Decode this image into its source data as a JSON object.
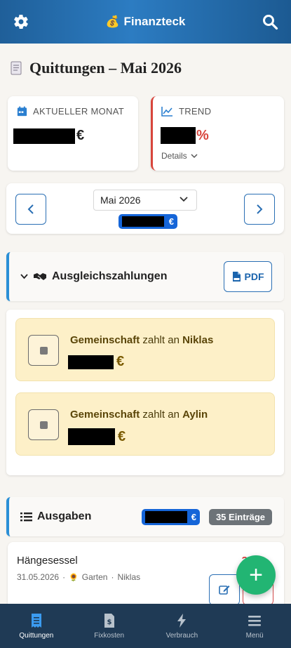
{
  "header": {
    "title": "Finanzteck",
    "brand_icon": "money-bag-icon",
    "left_icon": "gear-icon",
    "right_icon": "search-icon"
  },
  "page": {
    "title": "Quittungen – Mai 2026",
    "title_icon": "receipt-icon"
  },
  "stats": {
    "current_month": {
      "label": "AKTUELLER MONAT",
      "currency": "€"
    },
    "trend": {
      "label": "TREND",
      "unit": "%",
      "details_label": "Details"
    }
  },
  "month_nav": {
    "selected": "Mai 2026",
    "total_currency": "€"
  },
  "settlement": {
    "title": "Ausgleichszahlungen",
    "pdf_label": "PDF",
    "payments": [
      {
        "from": "Gemeinschaft",
        "verb": "zahlt an",
        "to": "Niklas",
        "currency": "€"
      },
      {
        "from": "Gemeinschaft",
        "verb": "zahlt an",
        "to": "Aylin",
        "currency": "€"
      }
    ]
  },
  "expenses": {
    "title": "Ausgaben",
    "total_currency": "€",
    "count_label": "35 Einträge",
    "items": [
      {
        "name": "Hängesessel",
        "date": "31.05.2026",
        "separator": "·",
        "category": "Garten",
        "person": "Niklas",
        "amount_visible": "3"
      }
    ]
  },
  "fab_label": "+",
  "bottom_nav": [
    {
      "label": "Quittungen",
      "icon": "receipt-icon",
      "active": true
    },
    {
      "label": "Fixkosten",
      "icon": "invoice-dollar-icon",
      "active": false
    },
    {
      "label": "Verbrauch",
      "icon": "bolt-icon",
      "active": false
    },
    {
      "label": "Menü",
      "icon": "hamburger-icon",
      "active": false
    }
  ],
  "colors": {
    "accent": "#2a6fb4",
    "header_bg": "#2c7cc2",
    "trend_red": "#d8453c",
    "pill_blue": "#1565d8",
    "payment_bg": "#fdf0c8",
    "fab_green": "#22b573",
    "nav_bg": "#1f3a55"
  }
}
